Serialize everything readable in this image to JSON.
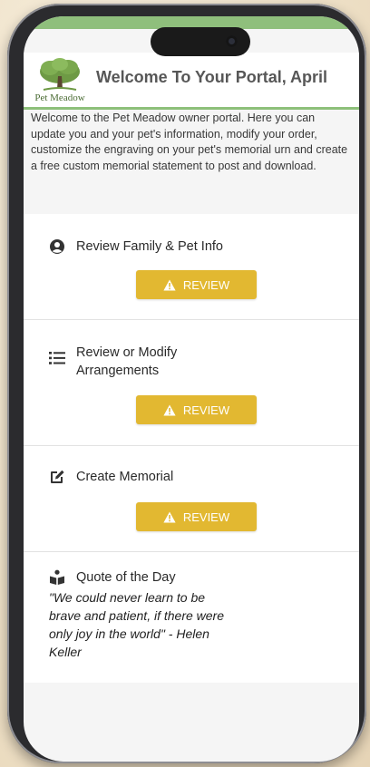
{
  "header": {
    "logo_text": "Pet Meadow",
    "title": "Welcome To Your Portal, April"
  },
  "intro": "Welcome to the Pet Meadow owner portal. Here you can update you and your pet's information, modify your order, customize the engraving on your pet's memorial urn and create a free custom memorial statement to post and download.",
  "cards": [
    {
      "title": "Review Family & Pet Info",
      "icon": "user-circle-icon",
      "button": "REVIEW"
    },
    {
      "title": "Review or Modify Arrangements",
      "icon": "list-icon",
      "button": "REVIEW"
    },
    {
      "title": "Create Memorial",
      "icon": "edit-icon",
      "button": "REVIEW"
    }
  ],
  "quote": {
    "title": "Quote of the Day",
    "icon": "reader-icon",
    "text": "\"We could never learn to be brave and patient, if there were only joy in the world\" - Helen Keller"
  },
  "colors": {
    "accent_green": "#8dc07a",
    "button_yellow": "#e2b831",
    "title_gray": "#575757"
  }
}
